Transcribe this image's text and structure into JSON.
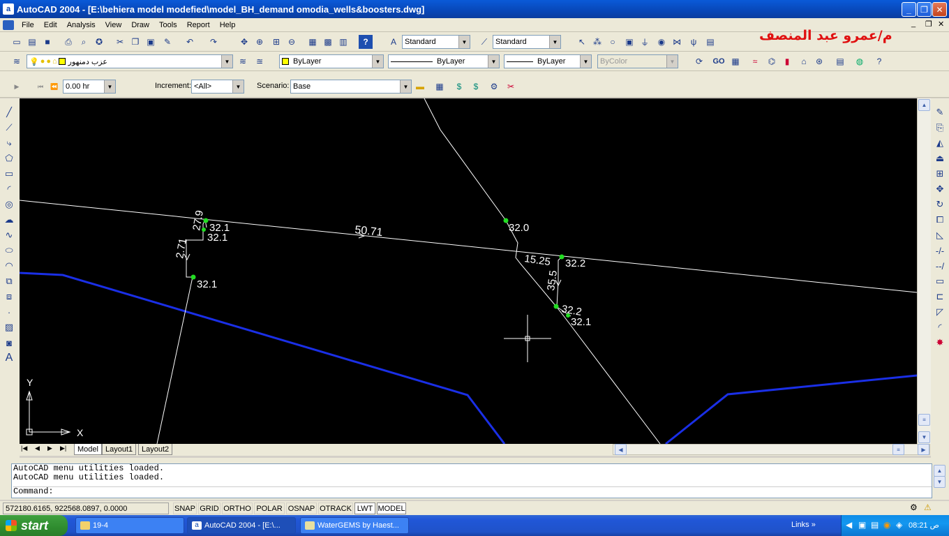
{
  "window": {
    "title": "AutoCAD 2004 - [E:\\behiera model modefied\\model_BH_demand omodia_wells&boosters.dwg]",
    "app_icon": "a",
    "controls": [
      "_",
      "❐",
      "✕"
    ],
    "doc_controls": [
      "_",
      "❐",
      "✕"
    ]
  },
  "menu": [
    "File",
    "Edit",
    "Analysis",
    "View",
    "Draw",
    "Tools",
    "Report",
    "Help"
  ],
  "arabic_title": "م/عمرو عبد المنصف",
  "toolbar_styles": {
    "text_style": "Standard",
    "dim_style": "Standard"
  },
  "toolbar_layers": {
    "layer_name": "عزب دمنهور",
    "color": "ByLayer",
    "linetype": "ByLayer",
    "lineweight": "ByLayer",
    "plotstyle": "ByColor"
  },
  "toolbar_scenario": {
    "time_value": "0.00 hr",
    "increment_label": "Increment:",
    "increment_value": "<All>",
    "scenario_label": "Scenario:",
    "scenario_value": "Base"
  },
  "drawing": {
    "labels": {
      "l_27_9": "27.9",
      "l_32_1_a": "32.1",
      "l_32_1_b": "32.1",
      "l_2_71": "2.71",
      "l_32_1_c": "32.1",
      "l_50_71": "50.71",
      "l_32_0": "32.0",
      "l_15_25": "15.25",
      "l_32_2": "32.2",
      "l_35_5": "35.5",
      "l_32_2_b": "32.2",
      "l_32_1_d": "32.1"
    },
    "ucs": {
      "x": "X",
      "y": "Y"
    },
    "colors": {
      "background": "#000000",
      "pipe": "#ffffff",
      "boundary": "#1a2fe6",
      "node": "#22dd22"
    }
  },
  "layout_tabs": [
    "Model",
    "Layout1",
    "Layout2"
  ],
  "command": {
    "lines": [
      "AutoCAD menu utilities loaded.",
      "AutoCAD menu utilities loaded."
    ],
    "prompt": "Command:"
  },
  "status": {
    "coords": "572180.6165, 922568.0897, 0.0000",
    "toggles": [
      "SNAP",
      "GRID",
      "ORTHO",
      "POLAR",
      "OSNAP",
      "OTRACK",
      "LWT",
      "MODEL"
    ]
  },
  "taskbar": {
    "start": "start",
    "tasks": [
      "19-4",
      "AutoCAD 2004 - [E:\\...",
      "WaterGEMS by Haest..."
    ],
    "links": "Links",
    "clock": "08:21 ص"
  }
}
